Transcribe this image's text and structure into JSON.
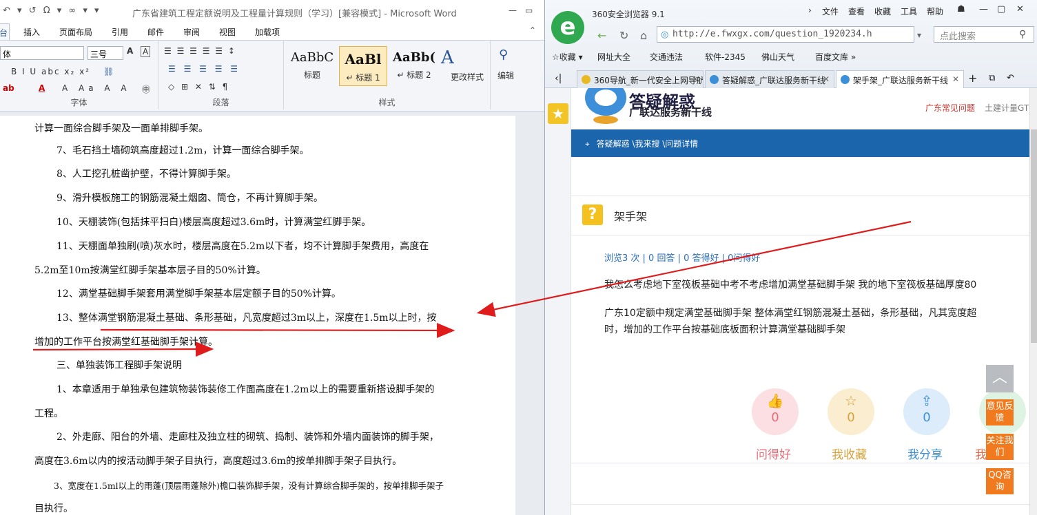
{
  "word": {
    "qat_symbols": "↶ ▾ ↺ Ω ▾ ∞ ▾ ▾",
    "doc_title": "广东省建筑工程定额说明及工程量计算规则（学习）[兼容模式] - Microsoft Word",
    "ctl_min": "—",
    "ctl_max": "▭",
    "tabs": [
      "台",
      "插入",
      "页面布局",
      "引用",
      "邮件",
      "审阅",
      "视图",
      "加载项"
    ],
    "font_name": "体",
    "font_size": "三号",
    "font_btns": "B  I  U  abc  x₂  x²",
    "font_btns2": "A  Aa  A  A",
    "para_btns": "☰  ☰  ☰  ☰  ☰  ↕",
    "para_btns2": "☰ ☰ ☰ ☰ ☰",
    "para_btns3": "◇  ⊞  ✕  ⇅  ¶",
    "groups": {
      "font": "字体",
      "para": "段落",
      "styles": "样式"
    },
    "styles": [
      {
        "sample": "AaBbC",
        "name": "标题"
      },
      {
        "sample": "AaBl",
        "name": "↵ 标题 1"
      },
      {
        "sample": "AaBb(",
        "name": "↵ 标题 2"
      }
    ],
    "change_styles": "更改样式",
    "edit": "编辑",
    "lines": [
      "计算一面综合脚手架及一面单排脚手架。",
      "7、毛石挡土墙砌筑高度超过1.2m，计算一面综合脚手架。",
      "8、人工挖孔桩凿护壁，不得计算脚手架。",
      "9、滑升模板施工的钢筋混凝土烟囱、筒仓，不再计算脚手架。",
      "10、天棚装饰(包括抹平扫白)楼层高度超过3.6m时，计算满堂红脚手架。",
      "11、天棚面单独刷(喷)灰水时，楼层高度在5.2m以下者，均不计算脚手架费用，高度在",
      "5.2m至10m按满堂红脚手架基本层子目的50%计算。",
      "12、满堂基础脚手架套用满堂脚手架基本层定额子目的50%计算。",
      "13、整体满堂钢筋混凝土基础、条形基础，凡宽度超过3m以上，深度在1.5m以上时，按",
      "增加的工作平台按满堂红基础脚手架计算。",
      "三、单独装饰工程脚手架说明",
      "1、本章适用于单独承包建筑物装饰装修工作面高度在1.2m以上的需要重新搭设脚手架的",
      "工程。",
      "2、外走廊、阳台的外墙、走廊柱及独立柱的砌筑、捣制、装饰和外墙内面装饰的脚手架，",
      "高度在3.6m以内的按活动脚手架子目执行，高度超过3.6m的按单排脚手架子目执行。",
      "3、宽度在1.5ml以上的雨蓬(顶层雨蓬除外)檐口装饰脚手架，没有计算综合脚手架的，按单排脚手架子",
      "目执行。"
    ]
  },
  "browser": {
    "app_title": "360安全浏览器 9.1",
    "menu": [
      "›",
      "文件",
      "查看",
      "收藏",
      "工具",
      "帮助"
    ],
    "url": "http://e.fwxgx.com/question_1920234.h",
    "search_placeholder": "点此搜索",
    "bookmarks": [
      "☆收藏 ▾",
      "网址大全",
      "交通违法",
      "软件-2345",
      "佛山天气",
      "百度文库 »"
    ],
    "tabs": [
      "360导航_新一代安全上网导航",
      "答疑解惑_广联达服务新干线",
      "架手架_广联达服务新干线"
    ],
    "site_name": "答疑解惑",
    "site_sub": "广联达服务新干线",
    "top_links": [
      "广东常见问题",
      "土建计量GT"
    ],
    "breadcrumb": "答疑解惑 \\我来搜 \\问题详情",
    "question_title": "架手架",
    "stats": "浏览3 次 | 0 回答 | 0 答得好 | 0问得好",
    "q_line1": "我怎么考虑地下室筏板基础中考不考虑增加满堂基础脚手架  我的地下室筏板基础厚度80",
    "q_line2": "广东10定额中规定满堂基础脚手架   整体满堂红钢筋混凝土基础，条形基础，凡其宽度超",
    "q_line3": "时，增加的工作平台按基础底板面积计算满堂基础脚手架",
    "actions": [
      {
        "icon": "👍",
        "count": "0",
        "label": "问得好",
        "color": "#e86a78",
        "bg": "#fbdfe2"
      },
      {
        "icon": "☆",
        "count": "0",
        "label": "我收藏",
        "color": "#d9a23c",
        "bg": "#fbedd0"
      },
      {
        "icon": "⇪",
        "count": "0",
        "label": "我分享",
        "color": "#3d8fd6",
        "bg": "#dcecfa"
      },
      {
        "icon": "",
        "count": "",
        "label": "我举报",
        "color": "#e06b4a",
        "bg": "#dff3e2"
      }
    ],
    "float_buttons": [
      "意见反馈",
      "关注我们",
      "QQ咨询"
    ],
    "totop": "︿"
  },
  "colors": {
    "arrow": "#e01b1b",
    "bluebar": "#1b65ad",
    "accent_orange": "#f07a1d"
  }
}
